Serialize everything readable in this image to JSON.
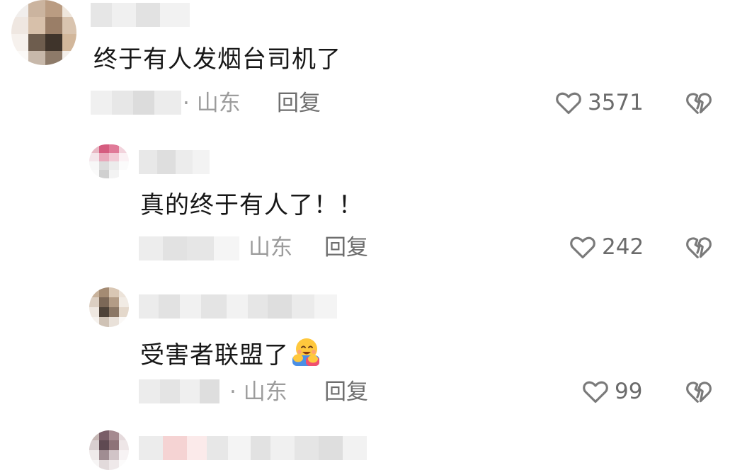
{
  "comments": [
    {
      "text": "终于有人发烟台司机了",
      "location": "· 山东",
      "reply_label": "回复",
      "like_count": "3571"
    },
    {
      "text": "真的终于有人了！！",
      "location": "山东",
      "reply_label": "回复",
      "like_count": "242"
    },
    {
      "text": "受害者联盟了",
      "location": "· 山东",
      "reply_label": "回复",
      "like_count": "99"
    }
  ],
  "icons": {
    "like": "heart-outline-icon",
    "dislike": "broken-heart-icon",
    "emoji": "hugging-face-emoji"
  },
  "colors": {
    "text": "#171717",
    "meta": "#9c9c9c",
    "reply": "#6e6e6e",
    "like_count": "#6b6b6b",
    "icon_stroke": "#7a7a7a"
  }
}
